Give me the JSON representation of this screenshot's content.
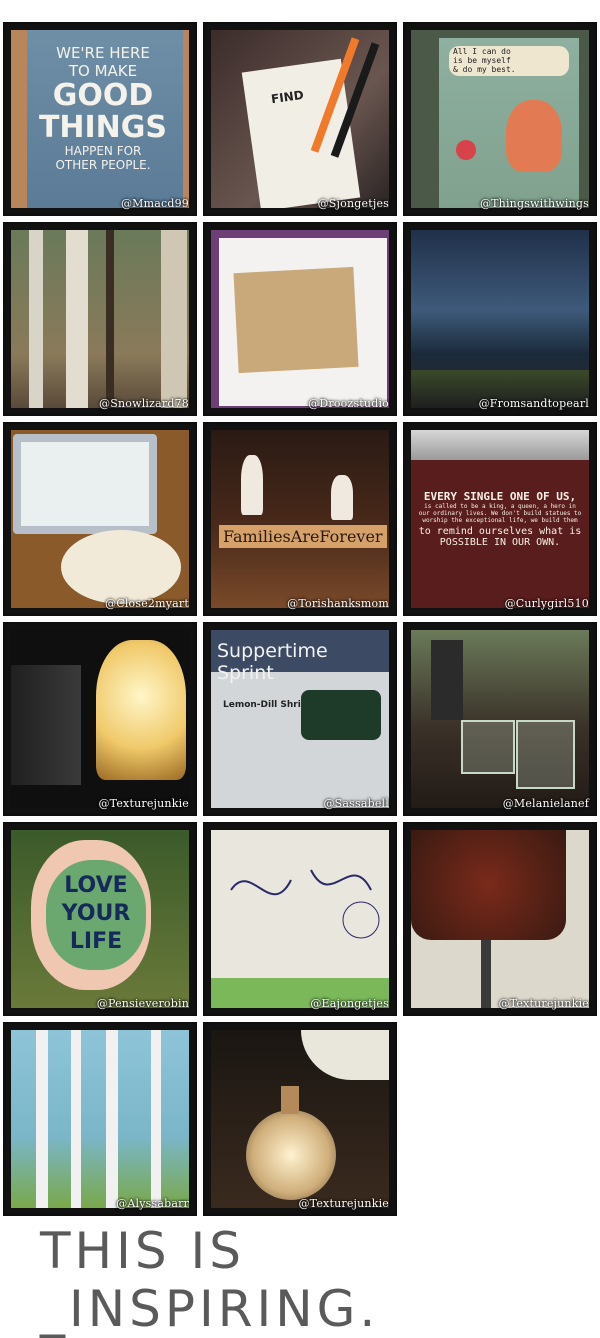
{
  "tiles": [
    {
      "credit": "@Mmacd99",
      "poster": [
        "WE'RE HERE",
        "TO MAKE",
        "GOOD",
        "THINGS",
        "HAPPEN FOR",
        "OTHER PEOPLE."
      ]
    },
    {
      "credit": "@Sjongetjes",
      "note": "FIND"
    },
    {
      "credit": "@Thingswithwings",
      "speech": [
        "All I can do",
        "is be myself",
        "& do my best."
      ]
    },
    {
      "credit": "@Snowlizard78"
    },
    {
      "credit": "@Droozstudio"
    },
    {
      "credit": "@Fromsandtopearl"
    },
    {
      "credit": "@Close2myart"
    },
    {
      "credit": "@Torishanksmom",
      "sign": "FamiliesAreForever"
    },
    {
      "credit": "@Curlygirl510",
      "poster": [
        "EVERY SINGLE ONE OF US,",
        "is called to be a king, a queen, a hero in",
        "our ordinary lives. We don't build statues to",
        "worship the exceptional life, we build them",
        "to remind ourselves what is",
        "POSSIBLE IN OUR OWN."
      ]
    },
    {
      "credit": "@Texturejunkie"
    },
    {
      "credit": "@Sassabell",
      "header": "Suppertime Sprint",
      "recipe": "Lemon-Dill Shrimp S"
    },
    {
      "credit": "@Melanielanef"
    },
    {
      "credit": "@Pensieverobin",
      "rock": [
        "LOVE",
        "YOUR",
        "LIFE"
      ]
    },
    {
      "credit": "@Eajongetjes"
    },
    {
      "credit": "@Texturejunkie"
    },
    {
      "credit": "@Alyssabarr"
    },
    {
      "credit": "@Texturejunkie"
    }
  ],
  "footer": "THIS IS _INSPIRING."
}
